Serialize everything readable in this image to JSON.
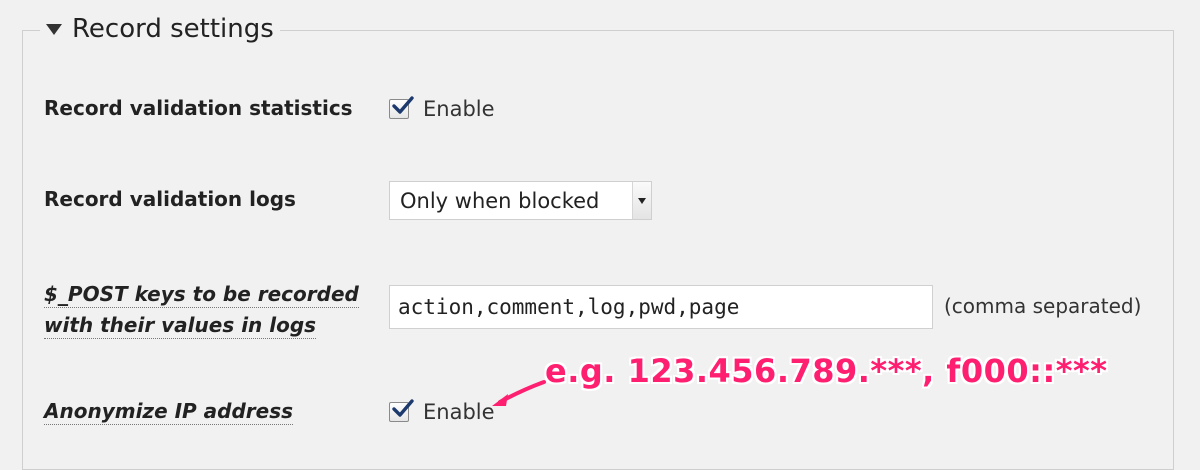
{
  "section": {
    "title": "Record settings"
  },
  "rows": {
    "stats": {
      "label": "Record validation statistics",
      "checkbox_label": "Enable",
      "checked": true
    },
    "logs": {
      "label": "Record validation logs",
      "selected": "Only when blocked"
    },
    "post_keys": {
      "label_line1": "$_POST keys to be recorded",
      "label_line2": "with their values in logs",
      "value": "action,comment,log,pwd,page",
      "hint": "(comma separated)"
    },
    "anonymize": {
      "label": "Anonymize IP address",
      "checkbox_label": "Enable",
      "checked": true
    }
  },
  "annotation": {
    "text": "e.g. 123.456.789.***, f000::***",
    "color": "#ff1f71"
  }
}
